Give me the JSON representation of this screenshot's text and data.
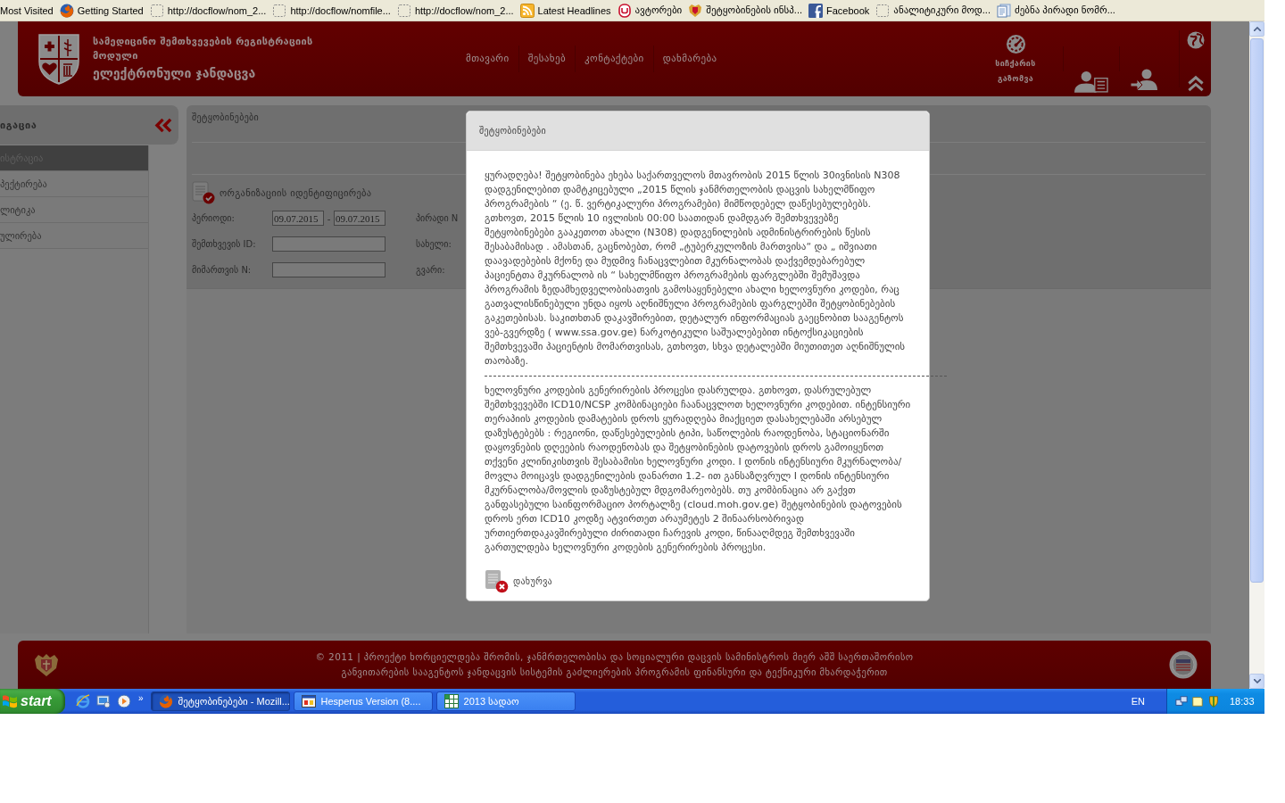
{
  "browser": {
    "bookmarks": [
      {
        "label": "Most Visited",
        "kind": "plain"
      },
      {
        "label": "Getting Started",
        "kind": "firefox"
      },
      {
        "label": "http://docflow/nom_2...",
        "kind": "blank"
      },
      {
        "label": "http://docflow/nomfile...",
        "kind": "blank"
      },
      {
        "label": "http://docflow/nom_2...",
        "kind": "blank"
      },
      {
        "label": "Latest Headlines",
        "kind": "rss"
      },
      {
        "label": "ავტორები",
        "kind": "arch"
      },
      {
        "label": "შეტყობინების ინსპ...",
        "kind": "emblem"
      },
      {
        "label": "Facebook",
        "kind": "facebook"
      },
      {
        "label": "ანალიტიკური მოდ...",
        "kind": "blank"
      },
      {
        "label": "ძებნა პირადი ნომრ...",
        "kind": "document"
      }
    ]
  },
  "header": {
    "title_lines": [
      "სამედიცინო შემთხვევების რეგისტრაციის",
      "მოდული"
    ],
    "subtitle": "ელექტრონული ჯანდაცვა",
    "nav": [
      {
        "label": "მთავარი"
      },
      {
        "label": "შესახებ"
      },
      {
        "label": "კონტაქტები"
      },
      {
        "label": "დახმარება"
      }
    ],
    "speed_test": [
      "სიჩქარის",
      "გაზომვა"
    ]
  },
  "sidebar": {
    "title": "იგაცია",
    "items": [
      {
        "label": "ისტრაცია",
        "selected": true
      },
      {
        "label": "პექტირება",
        "selected": false
      },
      {
        "label": "ლიტიკა",
        "selected": false
      },
      {
        "label": "ულირება",
        "selected": false
      }
    ]
  },
  "panel": {
    "title": "შეტყობინებები",
    "section": "ორგანიზაციის იდენტიფიცირება",
    "rows": [
      {
        "label": "პერიოდი:",
        "kind": "range",
        "from": "09.07.2015",
        "separator": "-",
        "to": "09.07.2015",
        "side_label": "პირადი N"
      },
      {
        "label": "შემთხვევის ID:",
        "kind": "text",
        "side_label": "სახელი:"
      },
      {
        "label": "მიმართვის N:",
        "kind": "text",
        "side_label": "გვარი:"
      }
    ]
  },
  "modal": {
    "title": "შეტყობინებები",
    "paragraphs": [
      "ყურადღება! შეტყობინება ეხება საქართველოს მთავრობის 2015 წლის 30ივნისის N308 დადგენილებით დამტკიცებული „2015 წლის ჯანმრთელობის დაცვის სახელმწიფო პროგრამების “ (ე. წ. ვერტიკალური პროგრამები) მიმწოდებელ დაწესებულებებს. გთხოვთ, 2015 წლის 10 ივლისის 00:00 საათიდან დამდგარ შემთხვევებზე შეტყობინებები გააკეთოთ ახალი (N308) დადგენილების ადმინისტრირების წესის შესაბამისად . ამასთან, გაცნობებთ, რომ „ტუბერკულოზის მართვისა“ და „ იშვიათი დაავადებების მქონე და მუდმივ ჩანაცვლებით მკურნალობას დაქვემდებარებულ პაციენტთა მკურნალობ ის “ სახელმწიფო პროგრამების ფარგლებში შემუშავდა პროგრამის ზედამხედველობისათვის გამოსაყენებელი ახალი ხელოვნური კოდები, რაც გათვალისწინებული უნდა იყოს აღნიშნული პროგრამების ფარგლებში შეტყობინებების გაკეთებისას. საკითხთან დაკავშირებით, დეტალურ ინფორმაციას გაეცნობით სააგენტოს ვებ-გვერდზე ( www.ssa.gov.ge) ნარკოტიკული საშუალებებით ინტოქსიკაციების შემთხვევაში პაციენტის მომართვისას, გთხოვთ, სხვა დეტალებში მიუთითეთ აღნიშნულის თაობაზე.",
      "ხელოვნური კოდების გენერირების პროცესი დასრულდა. გთხოვთ, დასრულებულ შემთხვევებში ICD10/NCSP კომბინაციები ჩაანაცვლოთ ხელოვნური კოდებით. ინტენსიური თერაპიის კოდების დამატების დროს ყურადღება მიაქციეთ დასახელებაში არსებულ დაზუსტებებს : რეგიონი, დაწესებულების ტიპი, საწოლების რაოდენობა, სტაციონარში დაყოვნების დღეების რაოდენობას და შეტყობინების დატოვების დროს გამოიყენოთ თქვენი კლინიკისთვის შესაბამისი ხელოვნური კოდი. I დონის ინტენსიური მკურნალობა/მოვლა მოიცავს დადგენილების დანართი 1.2- ით განსაზღვრულ I დონის ინტენსიური მკურნალობა/მოვლის დაზუსტებულ მდგომარეობებს. თუ კომბინაცია არ გაქვთ განფასებული საინფორმაციო პორტალზე (cloud.moh.gov.ge) შეტყობინების დატოვების დროს ერთ ICD10 კოდზე ატვირთეთ არაუმეტეს 2 შინაარსობრივად ურთიერთდაკავშირებული ძირითადი ჩარევის კოდი, წინააღმდეგ შემთხვევაში გართულდება ხელოვნური კოდების გენერირების პროცესი."
    ],
    "close_button": "დახურვა"
  },
  "footer": {
    "lines": [
      "© 2011 | პროექტი ხორციელდება შრომის, ჯანმრთელობისა და სოციალური დაცვის სამინისტროს მიერ აშშ საერთაშორისო",
      "განვითარების სააგენტოს ჯანდაცვის სისტემის გაძლიერების პროგრამის ფინანსური და ტექნიკური მხარდაჭერით"
    ]
  },
  "taskbar": {
    "start": "start",
    "overflow": "»",
    "tasks": [
      {
        "label": "შეტყობინებები - Mozill...",
        "kind": "firefox",
        "selected": true
      },
      {
        "label": "Hesperus Version (8....",
        "kind": "app",
        "selected": false
      },
      {
        "label": "2013 სადაო",
        "kind": "spreadsheet",
        "selected": false
      }
    ],
    "language": "EN",
    "clock": "18:33"
  }
}
